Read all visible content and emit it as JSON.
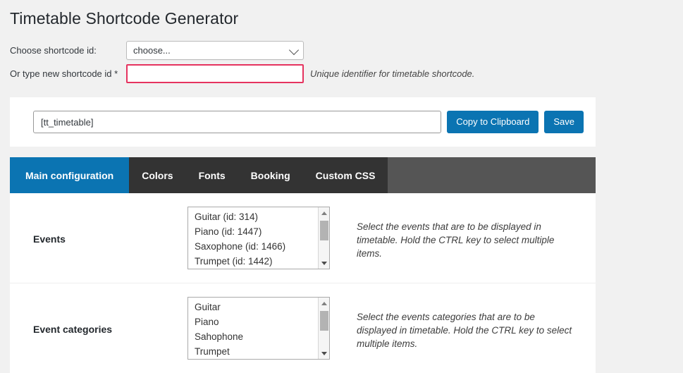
{
  "page": {
    "title": "Timetable Shortcode Generator"
  },
  "id_form": {
    "choose_label": "Choose shortcode id:",
    "choose_value": "choose...",
    "choose_options": [
      "choose..."
    ],
    "chevron_icon": "chevron-down-icon",
    "new_id_label": "Or type new shortcode id *",
    "new_id_value": "",
    "new_id_placeholder": "",
    "new_id_hint": "Unique identifier for timetable shortcode.",
    "required_border_color": "#e5335f"
  },
  "shortcode_bar": {
    "value": "[tt_timetable]",
    "placeholder": "[tt_timetable]",
    "copy_label": "Copy to Clipboard",
    "save_label": "Save",
    "button_color": "#0b74b2"
  },
  "tabs": {
    "active_color": "#0b74b2",
    "inactive_color": "#333333",
    "items": [
      {
        "label": "Main configuration",
        "active": true
      },
      {
        "label": "Colors",
        "active": false
      },
      {
        "label": "Fonts",
        "active": false
      },
      {
        "label": "Booking",
        "active": false
      },
      {
        "label": "Custom CSS",
        "active": false
      }
    ]
  },
  "settings": {
    "rows": [
      {
        "label": "Events",
        "options": [
          "Guitar (id: 314)",
          "Piano (id: 1447)",
          "Saxophone (id: 1466)",
          "Trumpet (id: 1442)"
        ],
        "description": "Select the events that are to be displayed in timetable. Hold the CTRL key to select multiple items."
      },
      {
        "label": "Event categories",
        "options": [
          "Guitar",
          "Piano",
          "Sahophone",
          "Trumpet"
        ],
        "description": "Select the events categories that are to be displayed in timetable. Hold the CTRL key to select multiple items."
      }
    ]
  }
}
